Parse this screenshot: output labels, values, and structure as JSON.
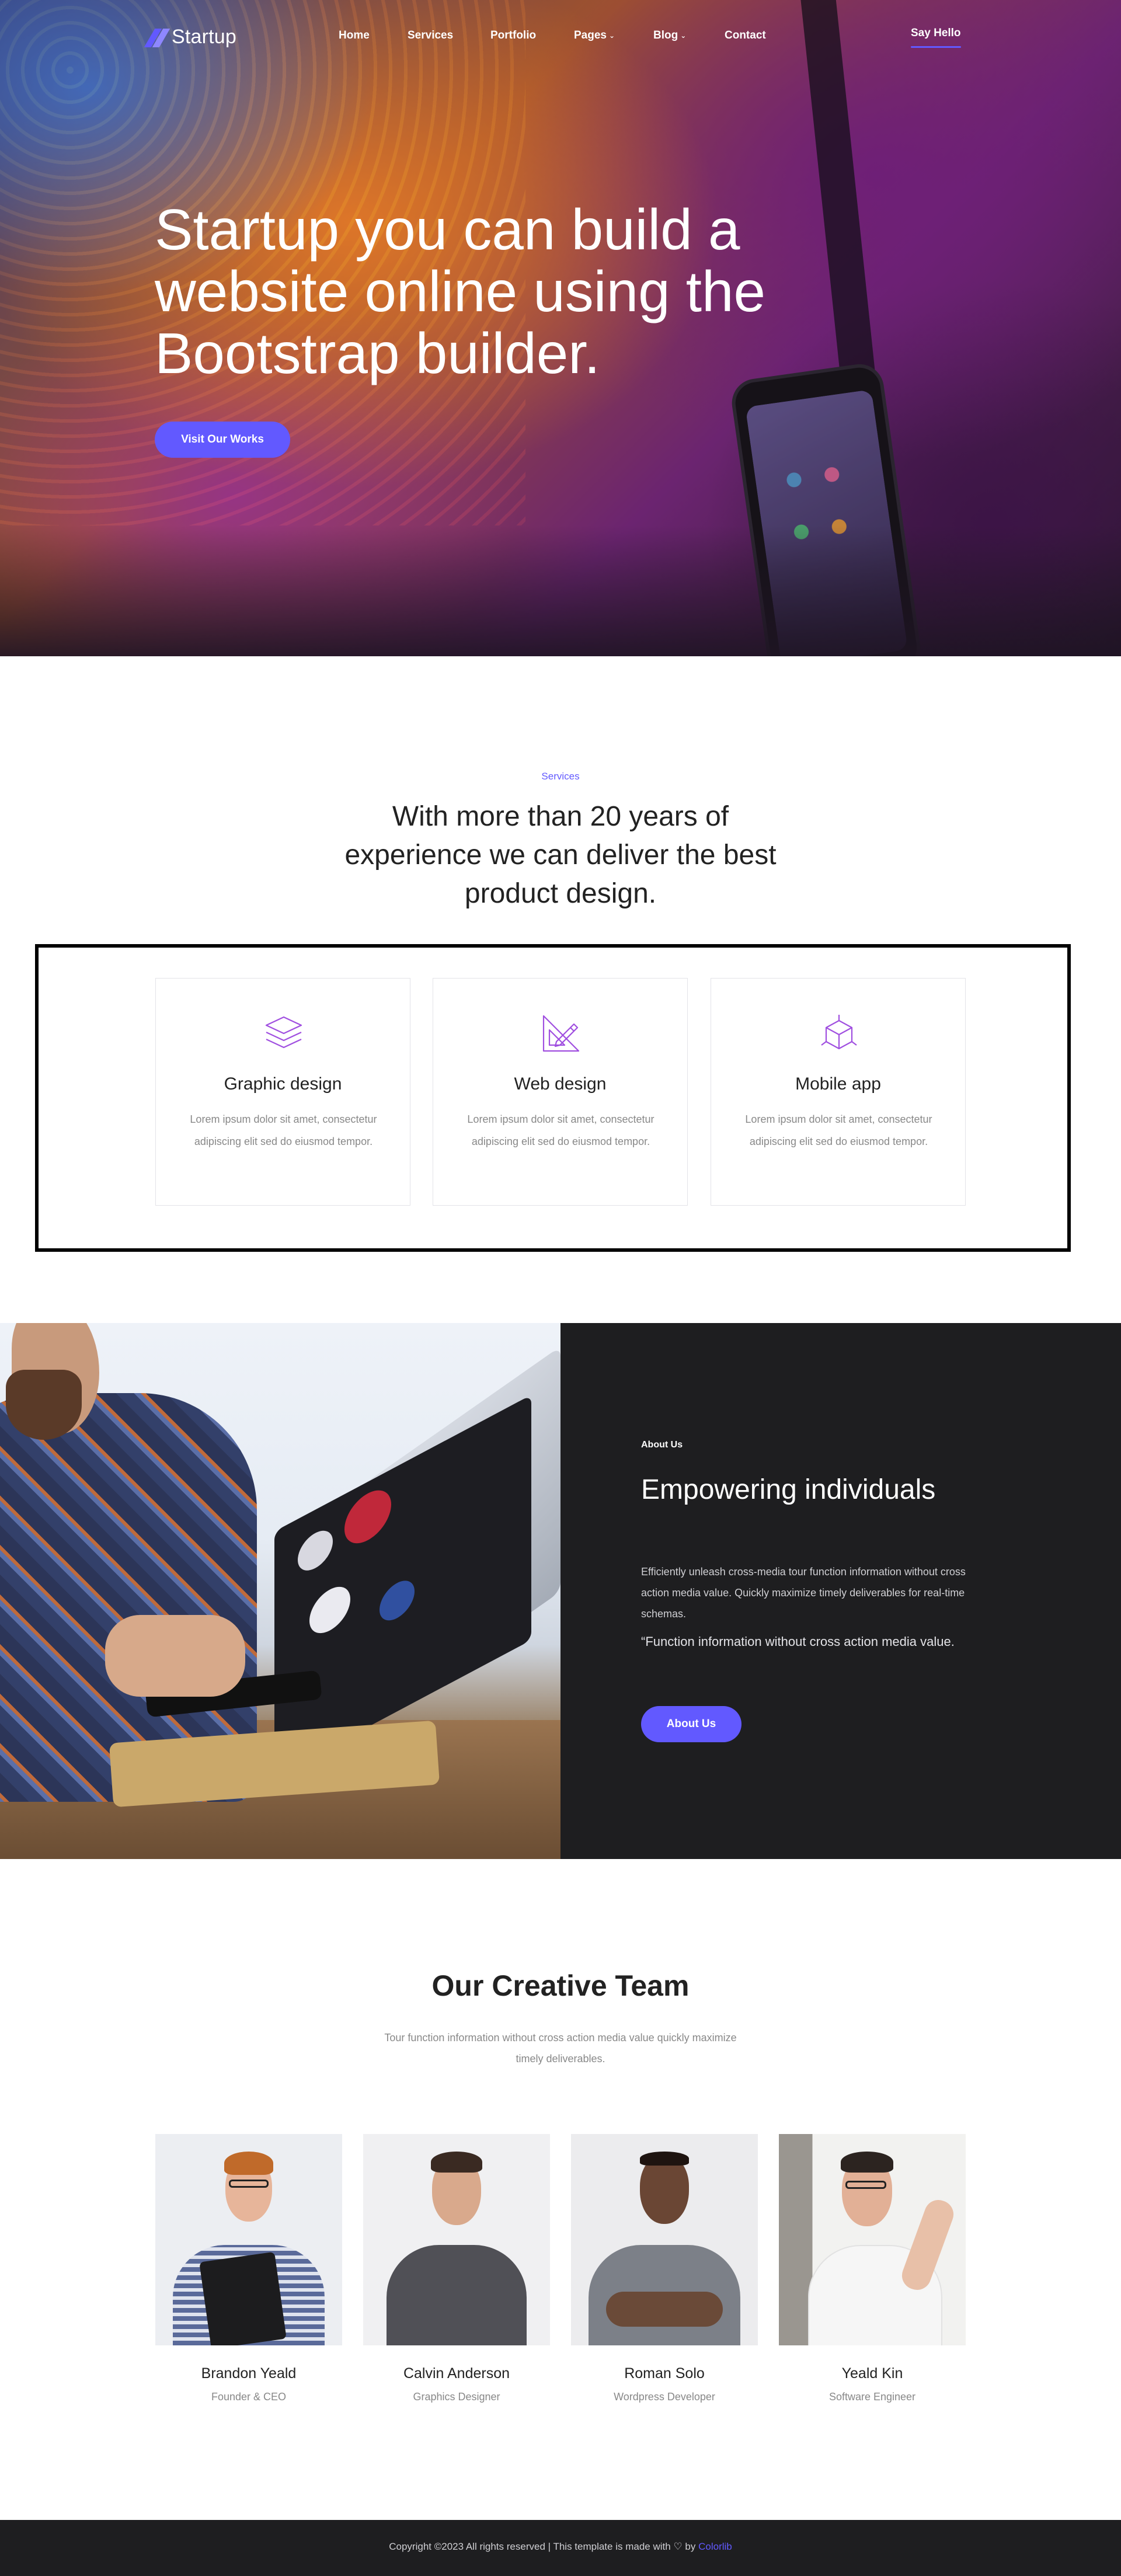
{
  "brand": {
    "name": "Startup",
    "accent": "#6259ff"
  },
  "nav": {
    "items": [
      {
        "label": "Home",
        "has_dropdown": false
      },
      {
        "label": "Services",
        "has_dropdown": false
      },
      {
        "label": "Portfolio",
        "has_dropdown": false
      },
      {
        "label": "Pages",
        "has_dropdown": true
      },
      {
        "label": "Blog",
        "has_dropdown": true
      },
      {
        "label": "Contact",
        "has_dropdown": false
      }
    ],
    "cta": "Say Hello"
  },
  "hero": {
    "title": "Startup you can build a website online using the Bootstrap builder.",
    "button": "Visit Our Works"
  },
  "services": {
    "eyebrow": "Services",
    "title": "With more than 20 years of experience we can deliver the best product design.",
    "cards": [
      {
        "icon": "layers-icon",
        "name": "Graphic design",
        "desc": "Lorem ipsum dolor sit amet, consectetur adipiscing elit sed do eiusmod tempor."
      },
      {
        "icon": "pencil-ruler-icon",
        "name": "Web design",
        "desc": "Lorem ipsum dolor sit amet, consectetur adipiscing elit sed do eiusmod tempor."
      },
      {
        "icon": "cube-icon",
        "name": "Mobile app",
        "desc": "Lorem ipsum dolor sit amet, consectetur adipiscing elit sed do eiusmod tempor."
      }
    ]
  },
  "about": {
    "eyebrow": "About Us",
    "title": "Empowering individuals",
    "text": "Efficiently unleash cross-media tour function information without cross action media value. Quickly maximize timely deliverables for real-time schemas.",
    "quote": "“Function information without cross action media value.",
    "button": "About Us"
  },
  "team": {
    "title": "Our Creative Team",
    "subtitle": "Tour function information without cross action media value quickly maximize timely deliverables.",
    "members": [
      {
        "name": "Brandon Yeald",
        "role": "Founder & CEO"
      },
      {
        "name": "Calvin Anderson",
        "role": "Graphics Designer"
      },
      {
        "name": "Roman Solo",
        "role": "Wordpress Developer"
      },
      {
        "name": "Yeald Kin",
        "role": "Software Engineer"
      }
    ]
  },
  "footer": {
    "text_before": "Copyright ©2023 All rights reserved | This template is made with",
    "heart": "♡",
    "by": "by",
    "link": "Colorlib"
  }
}
